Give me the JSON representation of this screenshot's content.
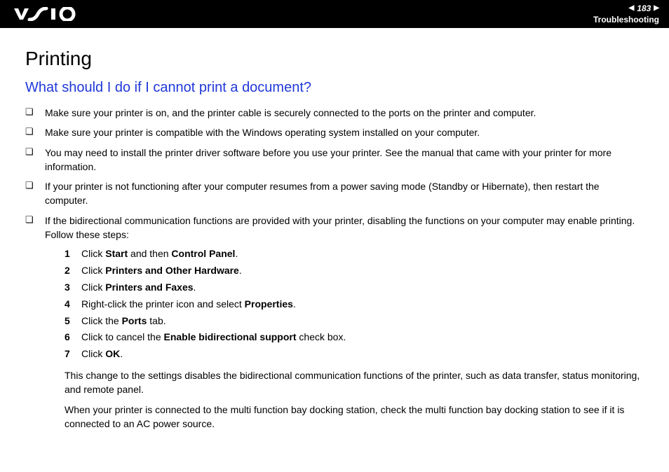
{
  "header": {
    "page_number": "183",
    "section": "Troubleshooting"
  },
  "title": "Printing",
  "subtitle": "What should I do if I cannot print a document?",
  "bullets": [
    "Make sure your printer is on, and the printer cable is securely connected to the ports on the printer and computer.",
    "Make sure your printer is compatible with the Windows operating system installed on your computer.",
    "You may need to install the printer driver software before you use your printer. See the manual that came with your printer for more information.",
    "If your printer is not functioning after your computer resumes from a power saving mode (Standby or Hibernate), then restart the computer.",
    "If the bidirectional communication functions are provided with your printer, disabling the functions on your computer may enable printing. Follow these steps:"
  ],
  "steps": [
    {
      "num": "1",
      "pre": "Click ",
      "b1": "Start",
      "mid": " and then ",
      "b2": "Control Panel",
      "post": "."
    },
    {
      "num": "2",
      "pre": "Click ",
      "b1": "Printers and Other Hardware",
      "mid": "",
      "b2": "",
      "post": "."
    },
    {
      "num": "3",
      "pre": "Click ",
      "b1": "Printers and Faxes",
      "mid": "",
      "b2": "",
      "post": "."
    },
    {
      "num": "4",
      "pre": "Right-click the printer icon and select ",
      "b1": "Properties",
      "mid": "",
      "b2": "",
      "post": "."
    },
    {
      "num": "5",
      "pre": "Click the ",
      "b1": "Ports",
      "mid": "",
      "b2": "",
      "post": " tab."
    },
    {
      "num": "6",
      "pre": "Click to cancel the ",
      "b1": "Enable bidirectional support",
      "mid": "",
      "b2": "",
      "post": " check box."
    },
    {
      "num": "7",
      "pre": "Click ",
      "b1": "OK",
      "mid": "",
      "b2": "",
      "post": "."
    }
  ],
  "closing": [
    "This change to the settings disables the bidirectional communication functions of the printer, such as data transfer, status monitoring, and remote panel.",
    "When your printer is connected to the multi function bay docking station, check the multi function bay docking station to see if it is connected to an AC power source."
  ]
}
